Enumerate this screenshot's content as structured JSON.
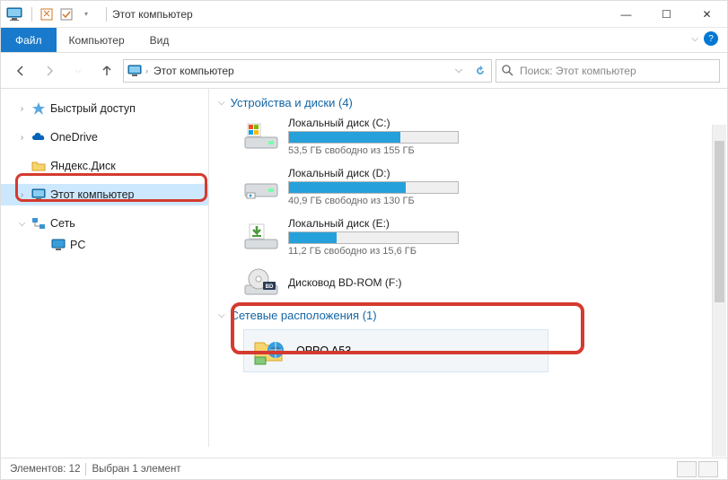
{
  "title": "Этот компьютер",
  "ribbon": {
    "file": "Файл",
    "tab_computer": "Компьютер",
    "tab_view": "Вид"
  },
  "address": {
    "root": "Этот компьютер",
    "search_placeholder": "Поиск: Этот компьютер"
  },
  "sidebar": {
    "quick": "Быстрый доступ",
    "onedrive": "OneDrive",
    "yandex": "Яндекс.Диск",
    "this_pc": "Этот компьютер",
    "network": "Сеть",
    "pc": "PC"
  },
  "groups": {
    "devices": "Устройства и диски (4)",
    "network": "Сетевые расположения (1)"
  },
  "drives": [
    {
      "name": "Локальный диск (C:)",
      "sub": "53,5 ГБ свободно из 155 ГБ",
      "fill": 66
    },
    {
      "name": "Локальный диск (D:)",
      "sub": "40,9 ГБ свободно из 130 ГБ",
      "fill": 69
    },
    {
      "name": "Локальный диск (E:)",
      "sub": "11,2 ГБ свободно из 15,6 ГБ",
      "fill": 28
    }
  ],
  "bdrom": "Дисковод BD-ROM (F:)",
  "net_item": "OPPO A53",
  "status": {
    "count": "Элементов: 12",
    "selected": "Выбран 1 элемент"
  }
}
